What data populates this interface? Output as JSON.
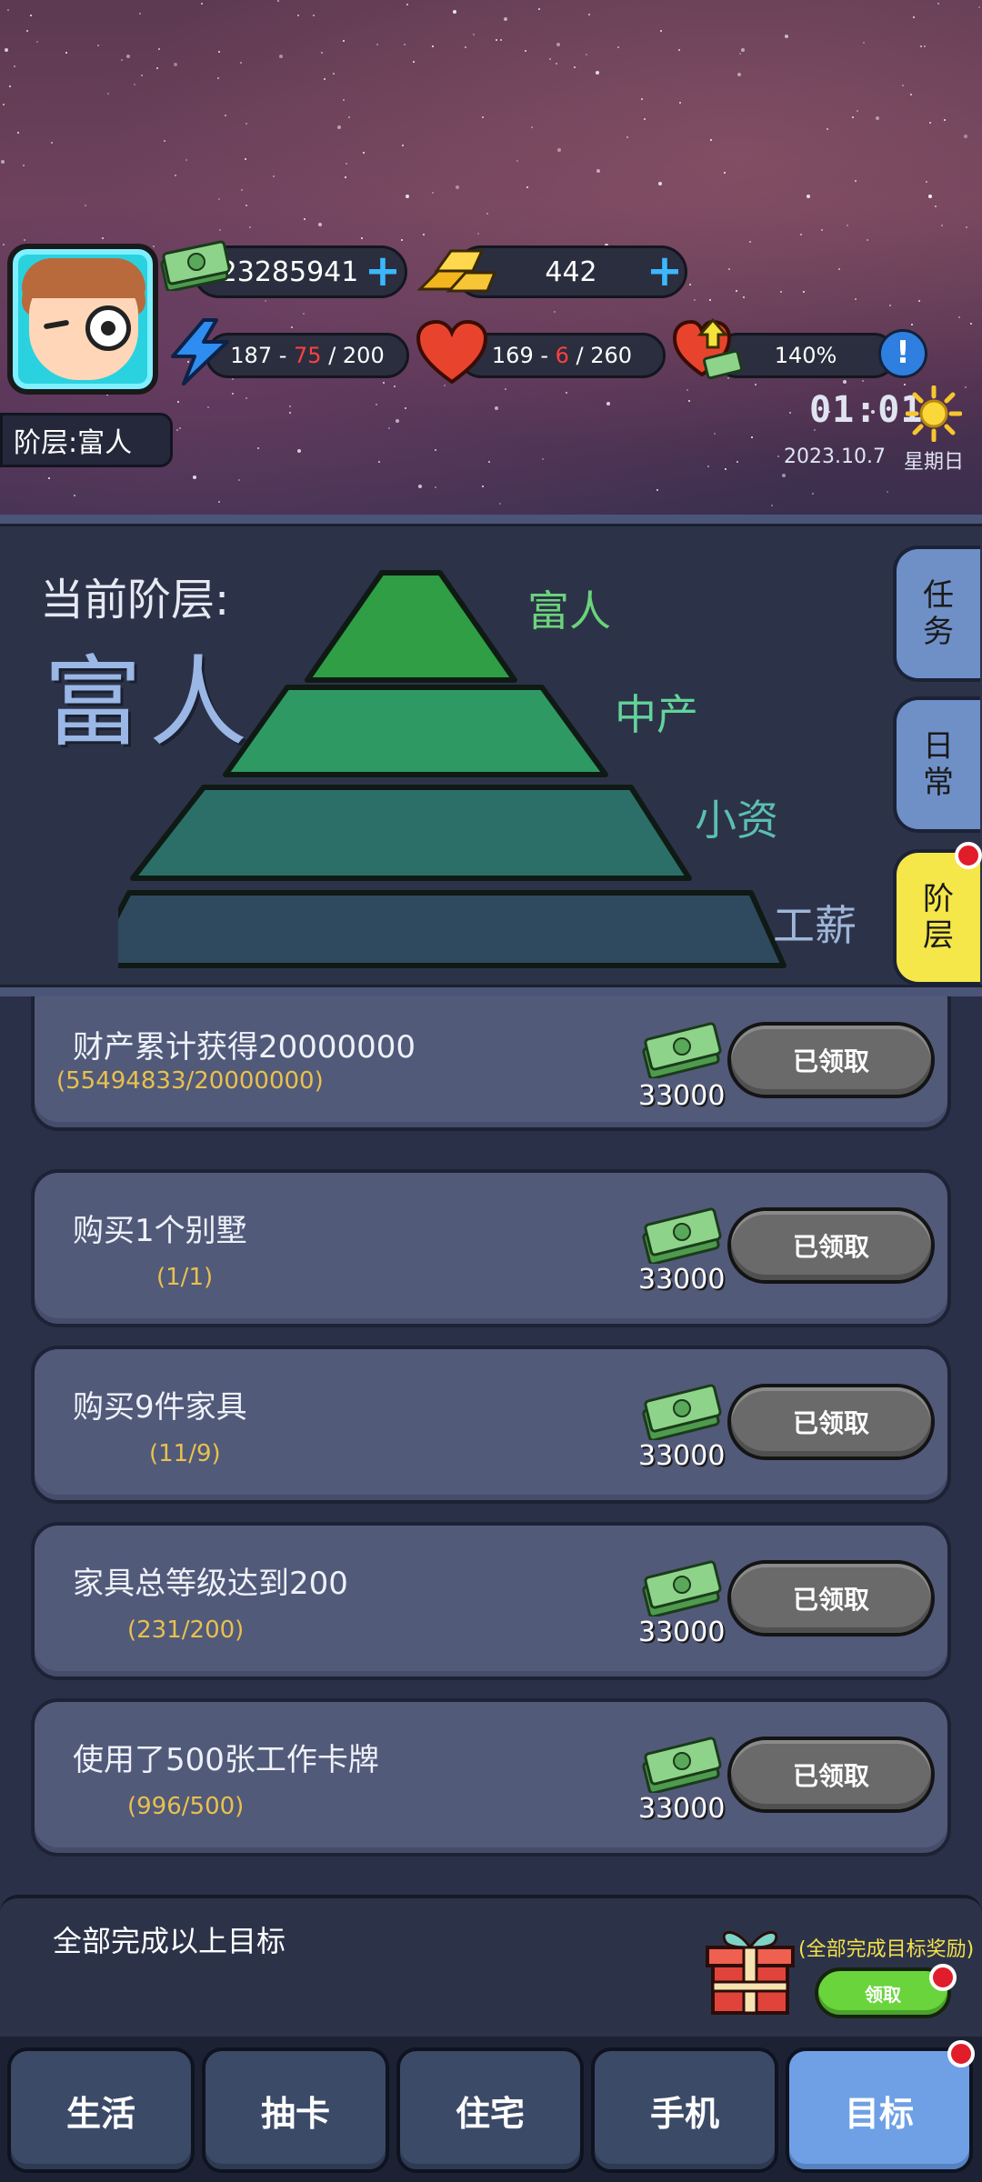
{
  "header": {
    "cash": "23285941",
    "gold": "442",
    "energy": {
      "current": "187",
      "minus": "75",
      "max": "200"
    },
    "health": {
      "current": "169",
      "minus": "6",
      "max": "260"
    },
    "mood": "140%",
    "rank_tag": "阶层:富人",
    "clock": "01:01",
    "date": "2023.10.7",
    "weekday": "星期日"
  },
  "pyramid": {
    "current_label": "当前阶层:",
    "current_value": "富人",
    "tiers": [
      "富人",
      "中产",
      "小资",
      "工薪"
    ],
    "tier_colors": [
      "#2f9e44",
      "#2f9964",
      "#2b6f68",
      "#2f4a5e"
    ]
  },
  "side_tabs": [
    {
      "label": "任务"
    },
    {
      "label": "日常"
    },
    {
      "label": "阶层"
    }
  ],
  "goals": [
    {
      "title": "财产累计获得20000000",
      "progress": "(55494833/20000000)",
      "reward": "33000",
      "button": "已领取"
    },
    {
      "title": "购买1个别墅",
      "progress": "(1/1)",
      "reward": "33000",
      "button": "已领取"
    },
    {
      "title": "购买9件家具",
      "progress": "(11/9)",
      "reward": "33000",
      "button": "已领取"
    },
    {
      "title": "家具总等级达到200",
      "progress": "(231/200)",
      "reward": "33000",
      "button": "已领取"
    },
    {
      "title": "使用了500张工作卡牌",
      "progress": "(996/500)",
      "reward": "33000",
      "button": "已领取"
    }
  ],
  "complete_all": {
    "title": "全部完成以上目标",
    "caption": "(全部完成目标奖励)",
    "button": "领取"
  },
  "nav": [
    {
      "label": "生活"
    },
    {
      "label": "抽卡"
    },
    {
      "label": "住宅"
    },
    {
      "label": "手机"
    },
    {
      "label": "目标"
    }
  ]
}
